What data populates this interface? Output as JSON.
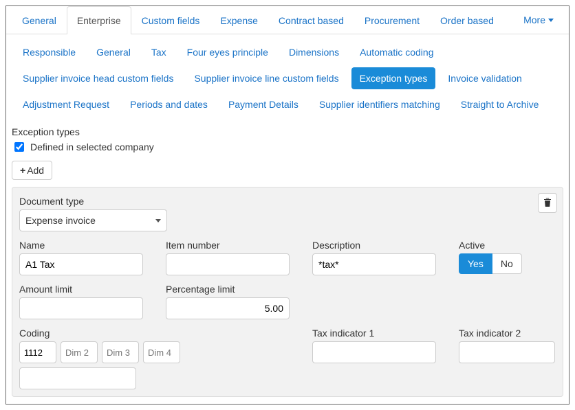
{
  "main_tabs": {
    "items": [
      {
        "label": "General"
      },
      {
        "label": "Enterprise"
      },
      {
        "label": "Custom fields"
      },
      {
        "label": "Expense"
      },
      {
        "label": "Contract based"
      },
      {
        "label": "Procurement"
      },
      {
        "label": "Order based"
      }
    ],
    "active_index": 1,
    "more_label": "More"
  },
  "sub_nav": {
    "items": [
      {
        "label": "Responsible"
      },
      {
        "label": "General"
      },
      {
        "label": "Tax"
      },
      {
        "label": "Four eyes principle"
      },
      {
        "label": "Dimensions"
      },
      {
        "label": "Automatic coding"
      },
      {
        "label": "Supplier invoice head custom fields"
      },
      {
        "label": "Supplier invoice line custom fields"
      },
      {
        "label": "Exception types"
      },
      {
        "label": "Invoice validation"
      },
      {
        "label": "Adjustment Request"
      },
      {
        "label": "Periods and dates"
      },
      {
        "label": "Payment Details"
      },
      {
        "label": "Supplier identifiers matching"
      },
      {
        "label": "Straight to Archive"
      }
    ],
    "selected_index": 8
  },
  "section": {
    "heading": "Exception types",
    "defined_checkbox_label": "Defined in selected company",
    "defined_checked": true,
    "add_label": "Add"
  },
  "panel": {
    "document_type": {
      "label": "Document type",
      "selected": "Expense invoice"
    },
    "name": {
      "label": "Name",
      "value": "A1 Tax"
    },
    "item_number": {
      "label": "Item number",
      "value": ""
    },
    "description": {
      "label": "Description",
      "value": "*tax*"
    },
    "active": {
      "label": "Active",
      "yes": "Yes",
      "no": "No",
      "value": true
    },
    "amount_limit": {
      "label": "Amount limit",
      "value": ""
    },
    "percentage_limit": {
      "label": "Percentage limit",
      "value": "5.00"
    },
    "coding": {
      "label": "Coding",
      "dim1": "1112",
      "dim2_placeholder": "Dim 2",
      "dim3_placeholder": "Dim 3",
      "dim4_placeholder": "Dim 4",
      "dim5": ""
    },
    "tax_indicator_1": {
      "label": "Tax indicator 1",
      "value": ""
    },
    "tax_indicator_2": {
      "label": "Tax indicator 2",
      "value": ""
    }
  }
}
